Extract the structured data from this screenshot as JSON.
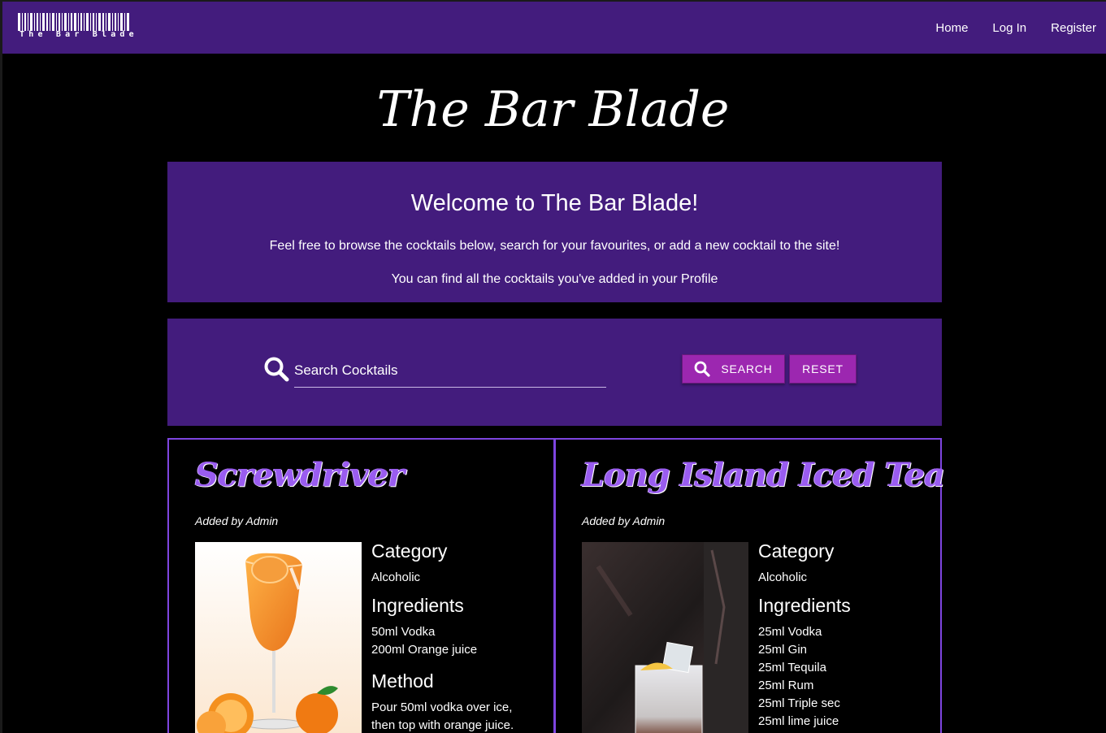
{
  "nav": {
    "logo_text": "The Bar Blade",
    "links": [
      "Home",
      "Log In",
      "Register"
    ]
  },
  "title": "The Bar Blade",
  "welcome": {
    "heading": "Welcome to The Bar Blade!",
    "line1": "Feel free to browse the cocktails below, search for your favourites, or add a new cocktail to the site!",
    "line2": "You can find all the cocktails you've added in your Profile"
  },
  "search": {
    "placeholder": "Search Cocktails",
    "search_label": "SEARCH",
    "reset_label": "RESET"
  },
  "cocktails": [
    {
      "name": "Screwdriver",
      "added_by": "Added by Admin",
      "category_label": "Category",
      "category": "Alcoholic",
      "ingredients_label": "Ingredients",
      "ingredients": [
        "50ml Vodka",
        "200ml Orange juice"
      ],
      "method_label": "Method",
      "method": [
        "Pour 50ml vodka over ice,",
        "then top with orange juice."
      ]
    },
    {
      "name": "Long Island Iced Tea",
      "added_by": "Added by Admin",
      "category_label": "Category",
      "category": "Alcoholic",
      "ingredients_label": "Ingredients",
      "ingredients": [
        "25ml Vodka",
        "25ml Gin",
        "25ml Tequila",
        "25ml Rum",
        "25ml Triple sec",
        "25ml lime juice"
      ]
    }
  ],
  "colors": {
    "nav_bg": "#431c7d",
    "panel_bg": "#431c7d",
    "button": "#9c27b0",
    "card_border": "#7e45e0",
    "card_title": "#9a5cf0"
  }
}
